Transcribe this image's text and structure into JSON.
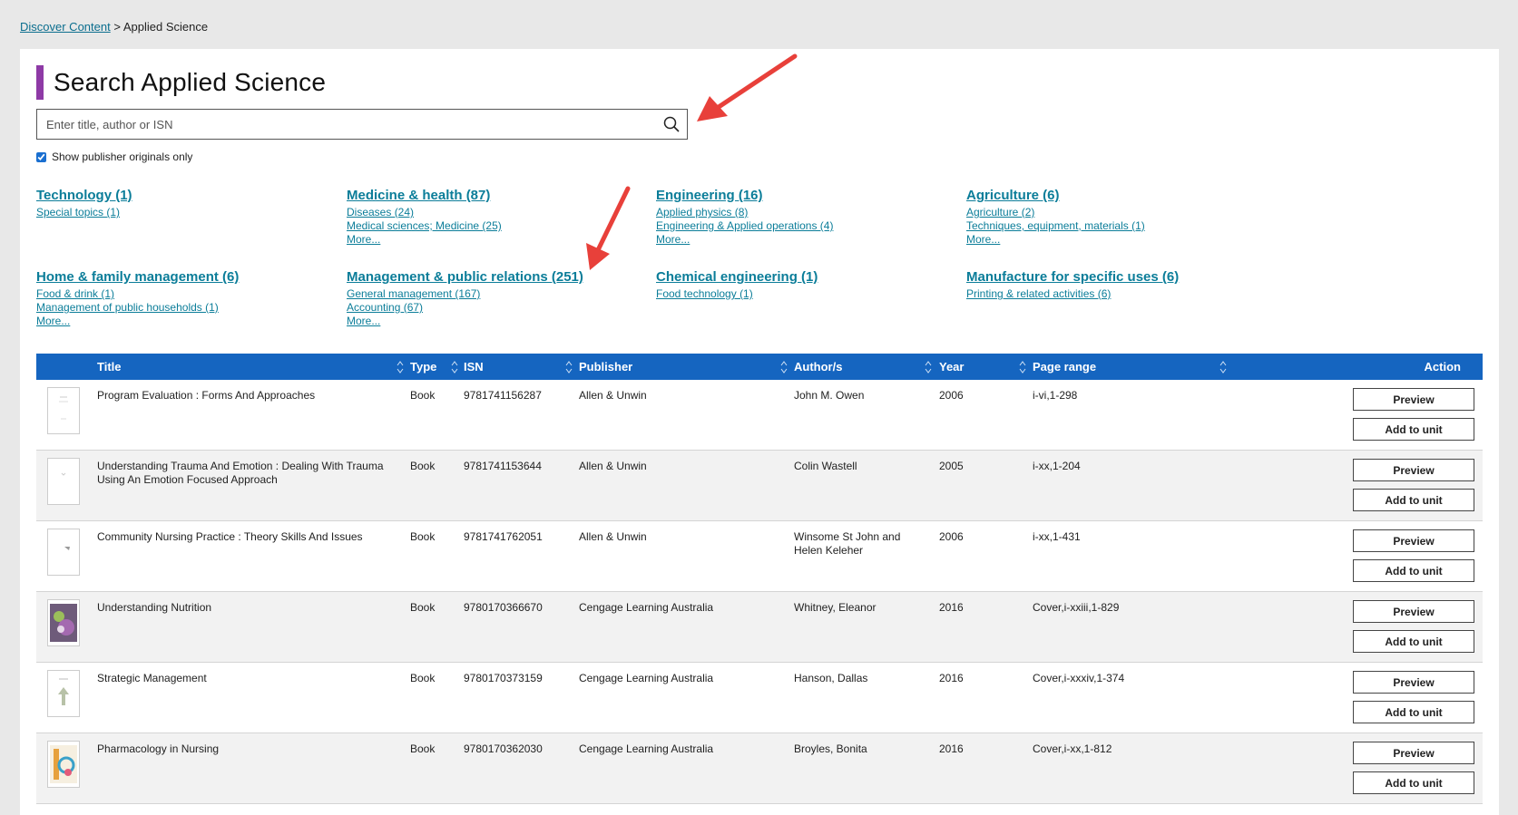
{
  "breadcrumb": {
    "root": "Discover Content",
    "separator": ">",
    "current": "Applied Science"
  },
  "page_title": "Search Applied Science",
  "search": {
    "placeholder": "Enter title, author or ISN",
    "value": ""
  },
  "publisher_filter": {
    "label": "Show publisher originals only",
    "checked": true
  },
  "categories": [
    {
      "title": "Technology (1)",
      "subs": [
        "Special topics (1)"
      ],
      "more": ""
    },
    {
      "title": "Medicine & health (87)",
      "subs": [
        "Diseases (24)",
        "Medical sciences; Medicine (25)"
      ],
      "more": "More..."
    },
    {
      "title": "Engineering (16)",
      "subs": [
        "Applied physics (8)",
        "Engineering & Applied operations (4)"
      ],
      "more": "More..."
    },
    {
      "title": "Agriculture (6)",
      "subs": [
        "Agriculture (2)",
        "Techniques, equipment, materials (1)"
      ],
      "more": "More..."
    },
    {
      "title": "Home & family management (6)",
      "subs": [
        "Food & drink (1)",
        "Management of public households (1)"
      ],
      "more": "More..."
    },
    {
      "title": "Management & public relations (251)",
      "subs": [
        "General management (167)",
        "Accounting (67)"
      ],
      "more": "More..."
    },
    {
      "title": "Chemical engineering (1)",
      "subs": [
        "Food technology (1)"
      ],
      "more": ""
    },
    {
      "title": "Manufacture for specific uses (6)",
      "subs": [
        "Printing & related activities (6)"
      ],
      "more": ""
    }
  ],
  "table": {
    "headers": {
      "title": "Title",
      "type": "Type",
      "isn": "ISN",
      "publisher": "Publisher",
      "authors": "Author/s",
      "year": "Year",
      "page_range": "Page range",
      "action": "Action"
    },
    "preview_label": "Preview",
    "add_label": "Add to unit",
    "rows": [
      {
        "title": "Program Evaluation : Forms And Approaches",
        "type": "Book",
        "isn": "9781741156287",
        "publisher": "Allen & Unwin",
        "authors": "John M. Owen",
        "year": "2006",
        "page_range": "i-vi,1-298"
      },
      {
        "title": "Understanding Trauma And Emotion : Dealing With Trauma Using An Emotion Focused Approach",
        "type": "Book",
        "isn": "9781741153644",
        "publisher": "Allen & Unwin",
        "authors": "Colin Wastell",
        "year": "2005",
        "page_range": "i-xx,1-204"
      },
      {
        "title": "Community Nursing Practice : Theory Skills And Issues",
        "type": "Book",
        "isn": "9781741762051",
        "publisher": "Allen & Unwin",
        "authors": "Winsome St John and Helen Keleher",
        "year": "2006",
        "page_range": "i-xx,1-431"
      },
      {
        "title": "Understanding Nutrition",
        "type": "Book",
        "isn": "9780170366670",
        "publisher": "Cengage Learning Australia",
        "authors": "Whitney, Eleanor",
        "year": "2016",
        "page_range": "Cover,i-xxiii,1-829"
      },
      {
        "title": "Strategic Management",
        "type": "Book",
        "isn": "9780170373159",
        "publisher": "Cengage Learning Australia",
        "authors": "Hanson, Dallas",
        "year": "2016",
        "page_range": "Cover,i-xxxiv,1-374"
      },
      {
        "title": "Pharmacology in Nursing",
        "type": "Book",
        "isn": "9780170362030",
        "publisher": "Cengage Learning Australia",
        "authors": "Broyles, Bonita",
        "year": "2016",
        "page_range": "Cover,i-xx,1-812"
      }
    ]
  },
  "colors": {
    "accent_bar": "#8e3aa6",
    "link": "#0b7d99",
    "table_header": "#1565c0",
    "annotation_arrow": "#e8403a"
  }
}
